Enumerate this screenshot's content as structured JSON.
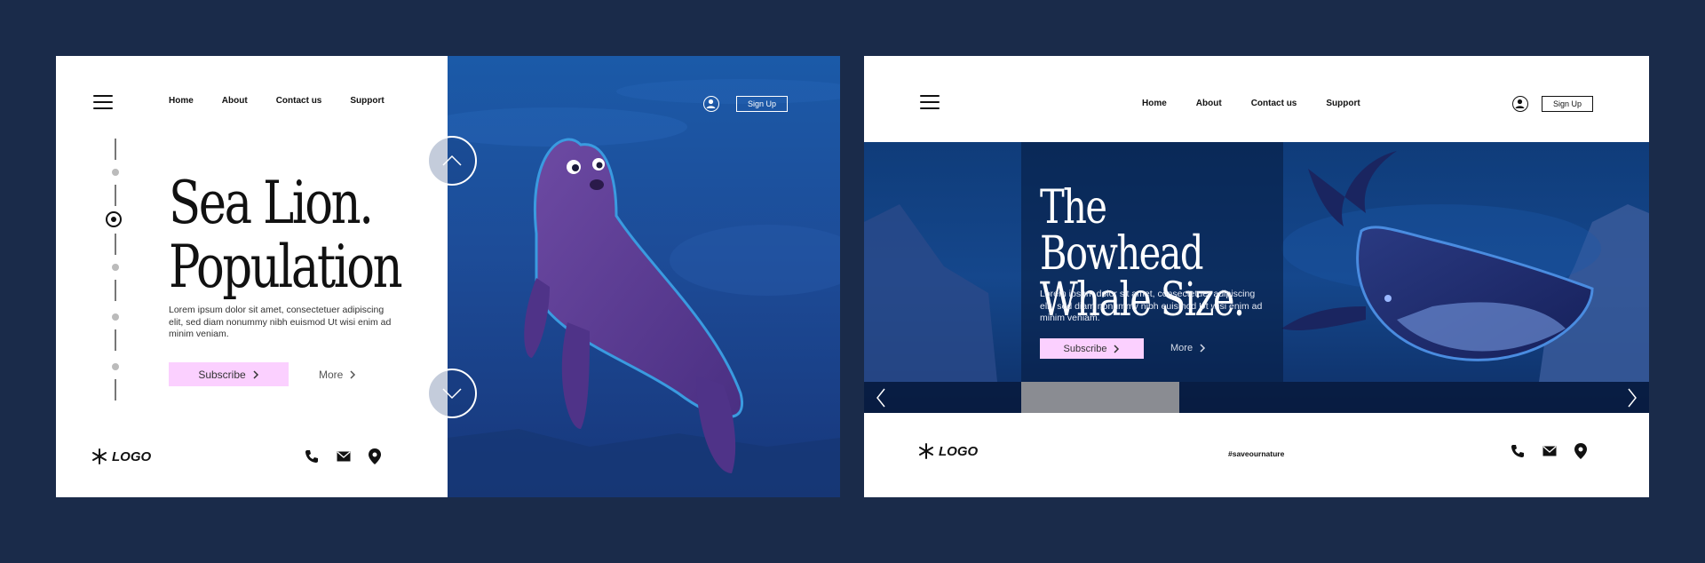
{
  "panel1": {
    "nav": [
      "Home",
      "About",
      "Contact us",
      "Support"
    ],
    "signup_label": "Sign Up",
    "title_line1": "Sea Lion.",
    "title_line2": "Population",
    "description": "Lorem ipsum dolor sit amet, consectetuer adipiscing elit, sed diam nonummy nibh euismod Ut wisi enim ad minim veniam.",
    "subscribe_label": "Subscribe",
    "more_label": "More",
    "logo_text": "LOGO",
    "stepper": {
      "steps": 5,
      "active_step": 2
    },
    "icons": [
      "menu-icon",
      "user-icon",
      "chevron-up-icon",
      "chevron-down-icon",
      "phone-icon",
      "mail-icon",
      "location-icon",
      "snowflake-icon"
    ]
  },
  "panel2": {
    "nav": [
      "Home",
      "About",
      "Contact us",
      "Support"
    ],
    "signup_label": "Sign Up",
    "title_line1": "The Bowhead",
    "title_line2": "Whale Size.",
    "description": "Lorem ipsum dolor sit amet, consectetuer adipiscing elit, sed diam nonummy nibh euismod Ut wisi enim ad minim veniam.",
    "subscribe_label": "Subscribe",
    "more_label": "More",
    "logo_text": "LOGO",
    "hashtag": "#saveournature",
    "icons": [
      "menu-icon",
      "user-icon",
      "chevron-left-icon",
      "chevron-right-icon",
      "phone-icon",
      "mail-icon",
      "location-icon",
      "snowflake-icon"
    ]
  },
  "colors": {
    "background": "#1a2b4a",
    "accent_pink": "#fbd0ff",
    "ocean_blue": "#1d4c98",
    "seal_purple": "#5a3f8f",
    "whale_navy": "#1f2a63"
  }
}
